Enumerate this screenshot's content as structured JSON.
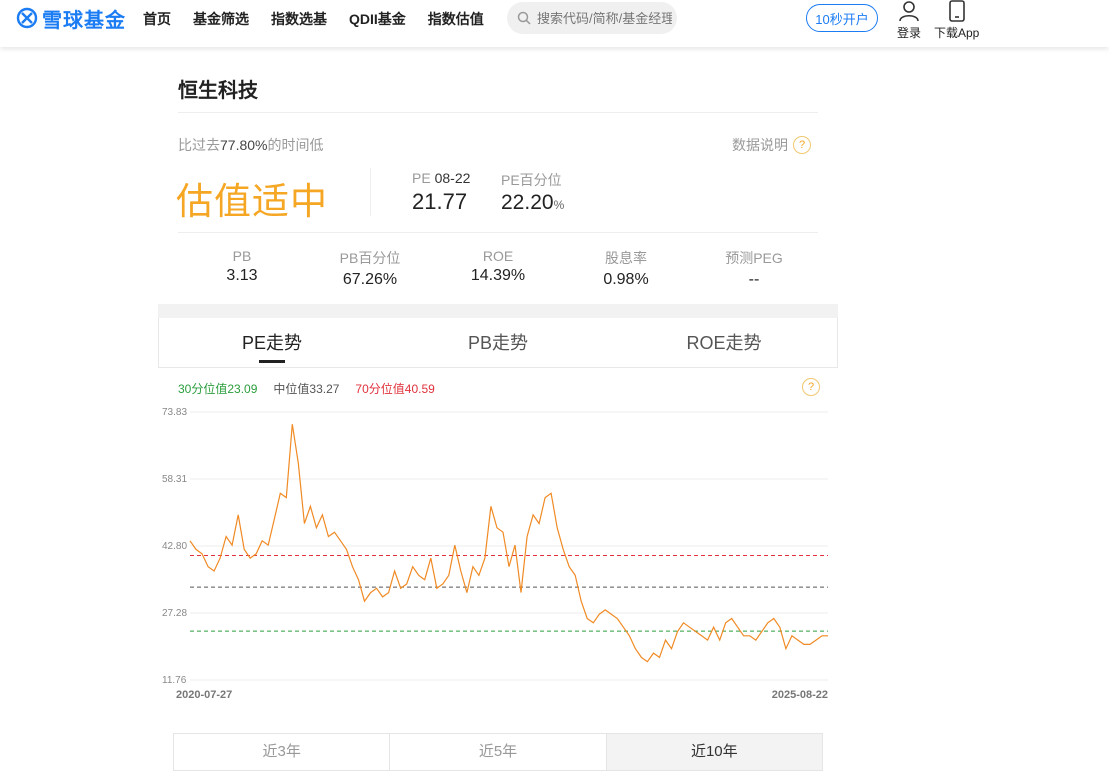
{
  "nav": {
    "logo_text": "雪球基金",
    "links": [
      "首页",
      "基金筛选",
      "指数选基",
      "QDII基金",
      "指数估值"
    ],
    "search_placeholder": "搜索代码/简称/基金经理",
    "open_account": "10秒开户",
    "login": "登录",
    "download": "下载App"
  },
  "index": {
    "name": "恒生科技",
    "compare_prefix": "比过去",
    "compare_pct": "77.80%",
    "compare_suffix": "的时间低",
    "explain": "数据说明",
    "verdict": "估值适中",
    "pe_label": "PE",
    "pe_date": "08-22",
    "pe_value": "21.77",
    "pe_pct_label": "PE百分位",
    "pe_pct_value": "22.20",
    "pe_pct_unit": "%"
  },
  "metrics": [
    {
      "label": "PB",
      "value": "3.13"
    },
    {
      "label": "PB百分位",
      "value": "67.26%"
    },
    {
      "label": "ROE",
      "value": "14.39%"
    },
    {
      "label": "股息率",
      "value": "0.98%"
    },
    {
      "label": "预测PEG",
      "value": "--"
    }
  ],
  "tabs": [
    {
      "label": "PE走势",
      "active": true
    },
    {
      "label": "PB走势",
      "active": false
    },
    {
      "label": "ROE走势",
      "active": false
    }
  ],
  "legend": {
    "p30": "30分位值23.09",
    "median": "中位值33.27",
    "p70": "70分位值40.59"
  },
  "range_buttons": [
    {
      "label": "近3年",
      "selected": false
    },
    {
      "label": "近5年",
      "selected": false
    },
    {
      "label": "近10年",
      "selected": true
    }
  ],
  "colors": {
    "brand": "#1b7cf3",
    "line": "#f08a24",
    "p30": "#2a9d3c",
    "median": "#555555",
    "p70": "#e0323c",
    "verdict": "#f5a623"
  },
  "chart_data": {
    "type": "line",
    "series_name": "PE",
    "y_ticks": [
      "73.83",
      "58.31",
      "42.80",
      "27.28",
      "11.76"
    ],
    "ylim": [
      11.76,
      73.83
    ],
    "x_start": "2020-07-27",
    "x_end": "2025-08-22",
    "reference_lines": [
      {
        "name": "30分位值",
        "value": 23.09
      },
      {
        "name": "中位值",
        "value": 33.27
      },
      {
        "name": "70分位值",
        "value": 40.59
      }
    ],
    "values": [
      44,
      42,
      41,
      38,
      37,
      40,
      45,
      43,
      50,
      42,
      40,
      41,
      44,
      43,
      49,
      55,
      54,
      71,
      62,
      48,
      52,
      47,
      50,
      45,
      46,
      44,
      42,
      38,
      35,
      30,
      32,
      33,
      31,
      32,
      37,
      33,
      34,
      38,
      36,
      35,
      40,
      33,
      34,
      36,
      43,
      37,
      32,
      38,
      36,
      40,
      52,
      47,
      46,
      38,
      43,
      32,
      45,
      50,
      48,
      54,
      55,
      47,
      42,
      38,
      36,
      30,
      26,
      25,
      27,
      28,
      27,
      26,
      24,
      22,
      19,
      17,
      16,
      18,
      17,
      21,
      19,
      23,
      25,
      24,
      23,
      22,
      21,
      24,
      21,
      25,
      26,
      24,
      22,
      22,
      21,
      23,
      25,
      26,
      24,
      19,
      22,
      21,
      20,
      20,
      21,
      22,
      22
    ]
  }
}
